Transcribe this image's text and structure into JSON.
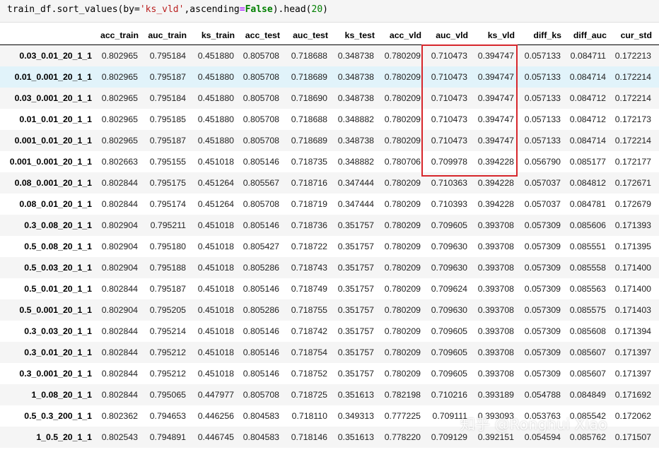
{
  "code": {
    "prefix": "train_df.sort_values(by=",
    "by_value": "'ks_vld'",
    "mid": ",ascending",
    "eq": "=",
    "false_kw": "False",
    "head_open": ").head(",
    "head_n": "20",
    "close": ")"
  },
  "table": {
    "columns": [
      "acc_train",
      "auc_train",
      "ks_train",
      "acc_test",
      "auc_test",
      "ks_test",
      "acc_vld",
      "auc_vld",
      "ks_vld",
      "diff_ks",
      "diff_auc",
      "cur_std"
    ],
    "rows": [
      {
        "index": "0.03_0.01_20_1_1",
        "values": [
          "0.802965",
          "0.795184",
          "0.451880",
          "0.805708",
          "0.718688",
          "0.348738",
          "0.780209",
          "0.710473",
          "0.394747",
          "0.057133",
          "0.084711",
          "0.172213"
        ]
      },
      {
        "index": "0.01_0.001_20_1_1",
        "values": [
          "0.802965",
          "0.795187",
          "0.451880",
          "0.805708",
          "0.718689",
          "0.348738",
          "0.780209",
          "0.710473",
          "0.394747",
          "0.057133",
          "0.084714",
          "0.172214"
        ]
      },
      {
        "index": "0.03_0.001_20_1_1",
        "values": [
          "0.802965",
          "0.795184",
          "0.451880",
          "0.805708",
          "0.718690",
          "0.348738",
          "0.780209",
          "0.710473",
          "0.394747",
          "0.057133",
          "0.084712",
          "0.172214"
        ]
      },
      {
        "index": "0.01_0.01_20_1_1",
        "values": [
          "0.802965",
          "0.795185",
          "0.451880",
          "0.805708",
          "0.718688",
          "0.348882",
          "0.780209",
          "0.710473",
          "0.394747",
          "0.057133",
          "0.084712",
          "0.172173"
        ]
      },
      {
        "index": "0.001_0.01_20_1_1",
        "values": [
          "0.802965",
          "0.795187",
          "0.451880",
          "0.805708",
          "0.718689",
          "0.348738",
          "0.780209",
          "0.710473",
          "0.394747",
          "0.057133",
          "0.084714",
          "0.172214"
        ]
      },
      {
        "index": "0.001_0.001_20_1_1",
        "values": [
          "0.802663",
          "0.795155",
          "0.451018",
          "0.805146",
          "0.718735",
          "0.348882",
          "0.780706",
          "0.709978",
          "0.394228",
          "0.056790",
          "0.085177",
          "0.172177"
        ]
      },
      {
        "index": "0.08_0.001_20_1_1",
        "values": [
          "0.802844",
          "0.795175",
          "0.451264",
          "0.805567",
          "0.718716",
          "0.347444",
          "0.780209",
          "0.710363",
          "0.394228",
          "0.057037",
          "0.084812",
          "0.172671"
        ]
      },
      {
        "index": "0.08_0.01_20_1_1",
        "values": [
          "0.802844",
          "0.795174",
          "0.451264",
          "0.805708",
          "0.718719",
          "0.347444",
          "0.780209",
          "0.710393",
          "0.394228",
          "0.057037",
          "0.084781",
          "0.172679"
        ]
      },
      {
        "index": "0.3_0.08_20_1_1",
        "values": [
          "0.802904",
          "0.795211",
          "0.451018",
          "0.805146",
          "0.718736",
          "0.351757",
          "0.780209",
          "0.709605",
          "0.393708",
          "0.057309",
          "0.085606",
          "0.171393"
        ]
      },
      {
        "index": "0.5_0.08_20_1_1",
        "values": [
          "0.802904",
          "0.795180",
          "0.451018",
          "0.805427",
          "0.718722",
          "0.351757",
          "0.780209",
          "0.709630",
          "0.393708",
          "0.057309",
          "0.085551",
          "0.171395"
        ]
      },
      {
        "index": "0.5_0.03_20_1_1",
        "values": [
          "0.802904",
          "0.795188",
          "0.451018",
          "0.805286",
          "0.718743",
          "0.351757",
          "0.780209",
          "0.709630",
          "0.393708",
          "0.057309",
          "0.085558",
          "0.171400"
        ]
      },
      {
        "index": "0.5_0.01_20_1_1",
        "values": [
          "0.802844",
          "0.795187",
          "0.451018",
          "0.805146",
          "0.718749",
          "0.351757",
          "0.780209",
          "0.709624",
          "0.393708",
          "0.057309",
          "0.085563",
          "0.171400"
        ]
      },
      {
        "index": "0.5_0.001_20_1_1",
        "values": [
          "0.802904",
          "0.795205",
          "0.451018",
          "0.805286",
          "0.718755",
          "0.351757",
          "0.780209",
          "0.709630",
          "0.393708",
          "0.057309",
          "0.085575",
          "0.171403"
        ]
      },
      {
        "index": "0.3_0.03_20_1_1",
        "values": [
          "0.802844",
          "0.795214",
          "0.451018",
          "0.805146",
          "0.718742",
          "0.351757",
          "0.780209",
          "0.709605",
          "0.393708",
          "0.057309",
          "0.085608",
          "0.171394"
        ]
      },
      {
        "index": "0.3_0.01_20_1_1",
        "values": [
          "0.802844",
          "0.795212",
          "0.451018",
          "0.805146",
          "0.718754",
          "0.351757",
          "0.780209",
          "0.709605",
          "0.393708",
          "0.057309",
          "0.085607",
          "0.171397"
        ]
      },
      {
        "index": "0.3_0.001_20_1_1",
        "values": [
          "0.802844",
          "0.795212",
          "0.451018",
          "0.805146",
          "0.718752",
          "0.351757",
          "0.780209",
          "0.709605",
          "0.393708",
          "0.057309",
          "0.085607",
          "0.171397"
        ]
      },
      {
        "index": "1_0.08_20_1_1",
        "values": [
          "0.802844",
          "0.795065",
          "0.447977",
          "0.805708",
          "0.718725",
          "0.351613",
          "0.782198",
          "0.710216",
          "0.393189",
          "0.054788",
          "0.084849",
          "0.171692"
        ]
      },
      {
        "index": "0.5_0.3_200_1_1",
        "values": [
          "0.802362",
          "0.794653",
          "0.446256",
          "0.804583",
          "0.718110",
          "0.349313",
          "0.777225",
          "0.709111",
          "0.393093",
          "0.053763",
          "0.085542",
          "0.172062"
        ]
      },
      {
        "index": "1_0.5_20_1_1",
        "values": [
          "0.802543",
          "0.794891",
          "0.446745",
          "0.804583",
          "0.718146",
          "0.351613",
          "0.778220",
          "0.709129",
          "0.392151",
          "0.054594",
          "0.085762",
          "0.171507"
        ]
      }
    ]
  },
  "highlight": {
    "hover_row_index": 1,
    "box_color": "#d7262b",
    "boxed_columns": [
      "auc_vld",
      "ks_vld"
    ]
  },
  "watermark": "知乎 @Ronghui Xiao"
}
